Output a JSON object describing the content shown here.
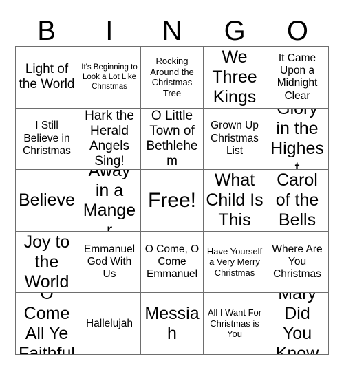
{
  "card": {
    "title": "BINGO Card",
    "header_letters": [
      "B",
      "I",
      "N",
      "G",
      "O"
    ],
    "grid_size": "5x5",
    "border_color": "#6e6e6e",
    "text_color": "#000000",
    "background_color": "#ffffff",
    "free_space_label": "Free!",
    "free_space_index": 12
  },
  "cells": [
    {
      "label": "Light of the World",
      "size": "lg",
      "column": "B",
      "row": 1
    },
    {
      "label": "It's Beginning to Look a Lot Like Christmas",
      "size": "xs",
      "column": "I",
      "row": 1
    },
    {
      "label": "Rocking Around the Christmas Tree",
      "size": "sm",
      "column": "N",
      "row": 1
    },
    {
      "label": "We Three Kings",
      "size": "xl",
      "column": "G",
      "row": 1
    },
    {
      "label": "It Came Upon a Midnight Clear",
      "size": "md",
      "column": "O",
      "row": 1
    },
    {
      "label": "I Still Believe in Christmas",
      "size": "md",
      "column": "B",
      "row": 2
    },
    {
      "label": "Hark the Herald Angels Sing!",
      "size": "lg",
      "column": "I",
      "row": 2
    },
    {
      "label": "O Little Town of Bethlehem",
      "size": "lg",
      "column": "N",
      "row": 2
    },
    {
      "label": "Grown Up Christmas List",
      "size": "md",
      "column": "G",
      "row": 2
    },
    {
      "label": "Glory in the Highest",
      "size": "xl",
      "column": "O",
      "row": 2
    },
    {
      "label": "Believe",
      "size": "xl",
      "column": "B",
      "row": 3
    },
    {
      "label": "Away in a Manger",
      "size": "xl",
      "column": "I",
      "row": 3
    },
    {
      "label": "Free!",
      "size": "free",
      "column": "N",
      "row": 3
    },
    {
      "label": "What Child Is This",
      "size": "xl",
      "column": "G",
      "row": 3
    },
    {
      "label": "Carol of the Bells",
      "size": "xl",
      "column": "O",
      "row": 3
    },
    {
      "label": "Joy to the World",
      "size": "xl",
      "column": "B",
      "row": 4
    },
    {
      "label": "Emmanuel God With Us",
      "size": "md",
      "column": "I",
      "row": 4
    },
    {
      "label": "O Come, O Come Emmanuel",
      "size": "md",
      "column": "N",
      "row": 4
    },
    {
      "label": "Have Yourself a Very Merry Christmas",
      "size": "sm",
      "column": "G",
      "row": 4
    },
    {
      "label": "Where Are You Christmas",
      "size": "md",
      "column": "O",
      "row": 4
    },
    {
      "label": "O Come All Ye Faithful",
      "size": "xl",
      "column": "B",
      "row": 5
    },
    {
      "label": "Hallelujah",
      "size": "md",
      "column": "I",
      "row": 5
    },
    {
      "label": "Messiah",
      "size": "xl",
      "column": "N",
      "row": 5
    },
    {
      "label": "All I Want For Christmas is You",
      "size": "sm",
      "column": "G",
      "row": 5
    },
    {
      "label": "Mary Did You Know",
      "size": "xl",
      "column": "O",
      "row": 5
    }
  ]
}
